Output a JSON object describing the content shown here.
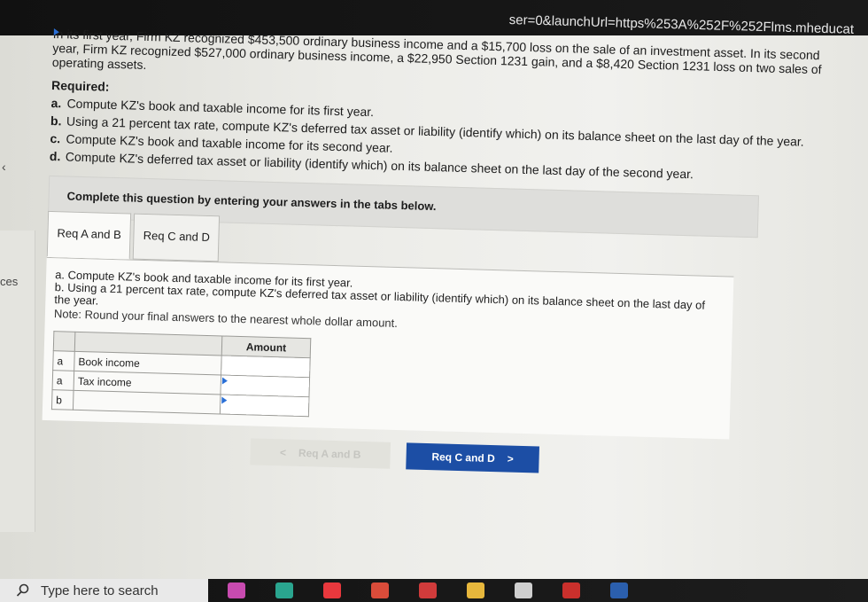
{
  "url_fragment": "ser=0&launchUrl=https%253A%252F%252Flms.mheducat",
  "left_rail": {
    "label": "ces",
    "chevron": "‹"
  },
  "question": {
    "intro": "In its first year, Firm KZ recognized $453,500 ordinary business income and a $15,700 loss on the sale of an investment asset. In its second year, Firm KZ recognized $527,000 ordinary business income, a $22,950 Section 1231 gain, and a $8,420 Section 1231 loss on two sales of operating assets.",
    "required_heading": "Required:",
    "requirements": [
      {
        "key": "a.",
        "text": "Compute KZ's book and taxable income for its first year."
      },
      {
        "key": "b.",
        "text": "Using a 21 percent tax rate, compute KZ's deferred tax asset or liability (identify which) on its balance sheet on the last day of the year."
      },
      {
        "key": "c.",
        "text": "Compute KZ's book and taxable income for its second year."
      },
      {
        "key": "d.",
        "text": "Compute KZ's deferred tax asset or liability (identify which) on its balance sheet on the last day of the second year."
      }
    ]
  },
  "instructions": "Complete this question by entering your answers in the tabs below.",
  "tabs": [
    {
      "label": "Req A and B",
      "active": true
    },
    {
      "label": "Req C and D",
      "active": false
    }
  ],
  "panel": {
    "line_a": "a. Compute KZ's book and taxable income for its first year.",
    "line_b": "b. Using a 21 percent tax rate, compute KZ's deferred tax asset or liability (identify which) on its balance sheet on the last day of the year.",
    "note": "Note: Round your final answers to the nearest whole dollar amount."
  },
  "answer_table": {
    "header_amount": "Amount",
    "rows": [
      {
        "letter": "a",
        "label": "Book income",
        "amount": ""
      },
      {
        "letter": "a",
        "label": "Tax income",
        "amount": ""
      },
      {
        "letter": "b",
        "label": "",
        "amount": ""
      }
    ]
  },
  "nav": {
    "prev_label": "Req A and B",
    "prev_chevron": "<",
    "next_label": "Req C and D",
    "next_chevron": ">"
  },
  "taskbar": {
    "search_placeholder": "Type here to search",
    "icons": [
      {
        "name": "flowers-icon",
        "color": "#c84bb0"
      },
      {
        "name": "edge-icon",
        "color": "#2aa58f"
      },
      {
        "name": "opera-icon",
        "color": "#e8383d"
      },
      {
        "name": "chrome-icon",
        "color": "#d94c3a"
      },
      {
        "name": "gmail-icon",
        "color": "#d03b3b"
      },
      {
        "name": "file-explorer-icon",
        "color": "#e7b73c"
      },
      {
        "name": "settings-icon",
        "color": "#cfcfcf"
      },
      {
        "name": "acrobat-icon",
        "color": "#c9302c"
      },
      {
        "name": "word-icon",
        "color": "#2b5fad"
      }
    ]
  }
}
